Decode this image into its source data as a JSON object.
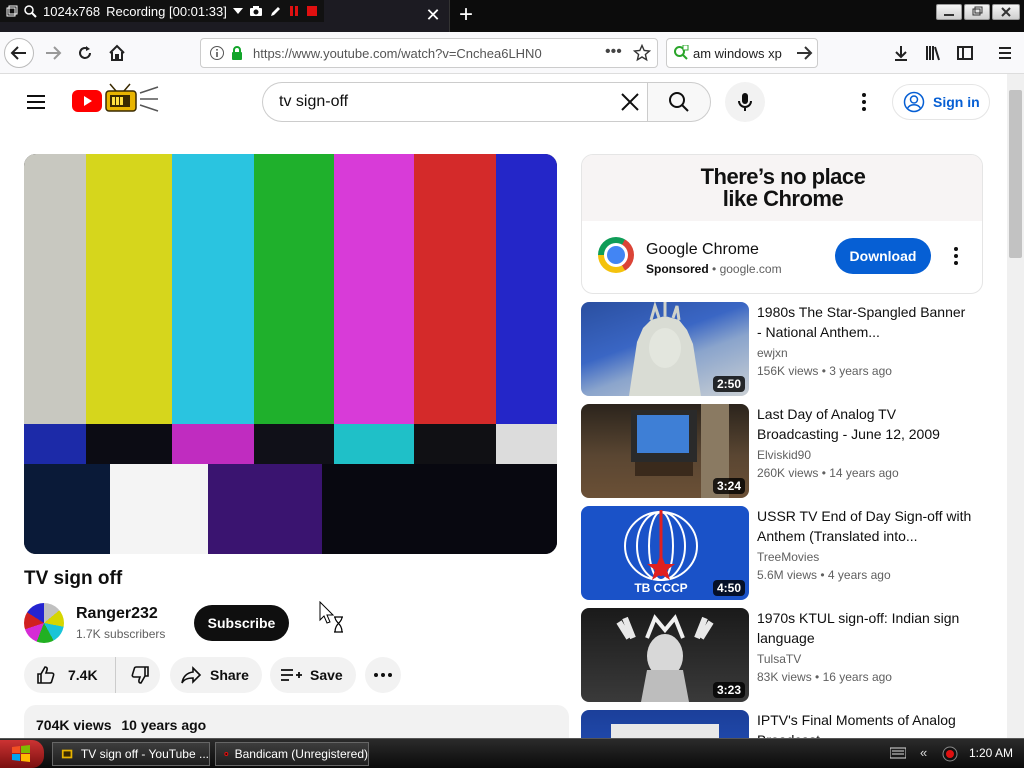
{
  "recorder": {
    "resolution": "1024x768",
    "status": "Recording [00:01:33]"
  },
  "browser": {
    "url": "https://www.youtube.com/watch?v=Cnchea6LHN0",
    "search_value": "am windows xp",
    "icons": [
      "back-icon",
      "forward-icon",
      "reload-icon",
      "home-icon",
      "info-icon",
      "lock-icon",
      "more-icon",
      "bookmark-star-icon",
      "go-arrow-icon",
      "download-icon",
      "library-icon",
      "sidebar-icon",
      "menu-icon"
    ]
  },
  "youtube": {
    "search_value": "tv sign-off",
    "signin_label": "Sign in"
  },
  "video": {
    "title": "TV sign off",
    "channel": "Ranger232",
    "subscribers": "1.7K subscribers",
    "subscribe_label": "Subscribe",
    "likes": "7.4K",
    "share_label": "Share",
    "save_label": "Save",
    "views": "704K views",
    "age": "10 years ago",
    "colors": [
      "#c8c8c0",
      "#d6d61c",
      "#2ac4e0",
      "#1fb02c",
      "#d83bd8",
      "#d42a2a",
      "#2426c8"
    ]
  },
  "ad": {
    "headline_line1": "There’s no place",
    "headline_line2": "like Chrome",
    "name": "Google Chrome",
    "sponsored": "Sponsored",
    "domain": "google.com",
    "download_label": "Download"
  },
  "recommendations": [
    {
      "title": "1980s The Star-Spangled Banner - National Anthem...",
      "channel": "ewjxn",
      "views": "156K views",
      "age": "3 years ago",
      "duration": "2:50"
    },
    {
      "title": "Last Day of Analog TV Broadcasting - June 12, 2009",
      "channel": "Elviskid90",
      "views": "260K views",
      "age": "14 years ago",
      "duration": "3:24"
    },
    {
      "title": "USSR TV End of Day Sign-off with Anthem (Translated into...",
      "channel": "TreeMovies",
      "views": "5.6M views",
      "age": "4 years ago",
      "duration": "4:50"
    },
    {
      "title": "1970s KTUL sign-off: Indian sign language",
      "channel": "TulsaTV",
      "views": "83K views",
      "age": "16 years ago",
      "duration": "3:23"
    },
    {
      "title": "IPTV's Final Moments of Analog Broadcast",
      "channel": "",
      "views": "",
      "age": "",
      "duration": ""
    }
  ],
  "taskbar": {
    "window1": "TV sign off - YouTube ...",
    "window2": "Bandicam (Unregistered)",
    "time": "1:20 AM"
  }
}
